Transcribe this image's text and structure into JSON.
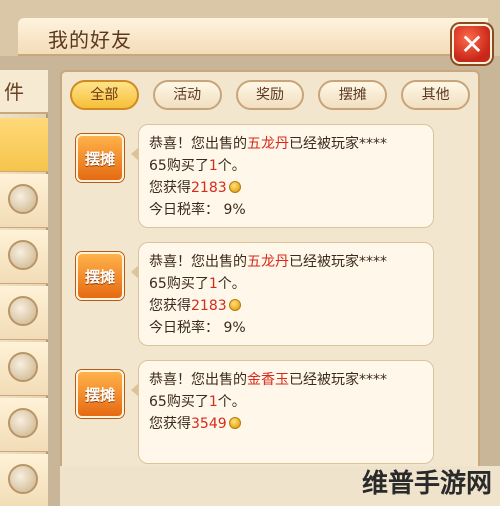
{
  "window": {
    "title": "我的好友",
    "close_glyph": "✕"
  },
  "sidebar": {
    "tab_label": "件"
  },
  "filters": [
    "全部",
    "活动",
    "奖励",
    "摆摊",
    "其他"
  ],
  "active_filter": 0,
  "messages": [
    {
      "icon_label": "摆摊",
      "line1_prefix": "恭喜！您出售的",
      "item": "五龙丹",
      "line1_suffix": "已经被玩家****",
      "line2": "65购买了",
      "count": "1",
      "line2_suffix": "个。",
      "earn_label": "您获得",
      "earn_value": "2183",
      "tax_label": "今日税率：",
      "tax_value": "9%"
    },
    {
      "icon_label": "摆摊",
      "line1_prefix": "恭喜！您出售的",
      "item": "五龙丹",
      "line1_suffix": "已经被玩家****",
      "line2": "65购买了",
      "count": "1",
      "line2_suffix": "个。",
      "earn_label": "您获得",
      "earn_value": "2183",
      "tax_label": "今日税率：",
      "tax_value": "9%"
    },
    {
      "icon_label": "摆摊",
      "line1_prefix": "恭喜！您出售的",
      "item": "金香玉",
      "line1_suffix": "已经被玩家****",
      "line2": "65购买了",
      "count": "1",
      "line2_suffix": "个。",
      "earn_label": "您获得",
      "earn_value": "3549",
      "tax_label": "",
      "tax_value": ""
    }
  ],
  "watermark": "维普手游网"
}
